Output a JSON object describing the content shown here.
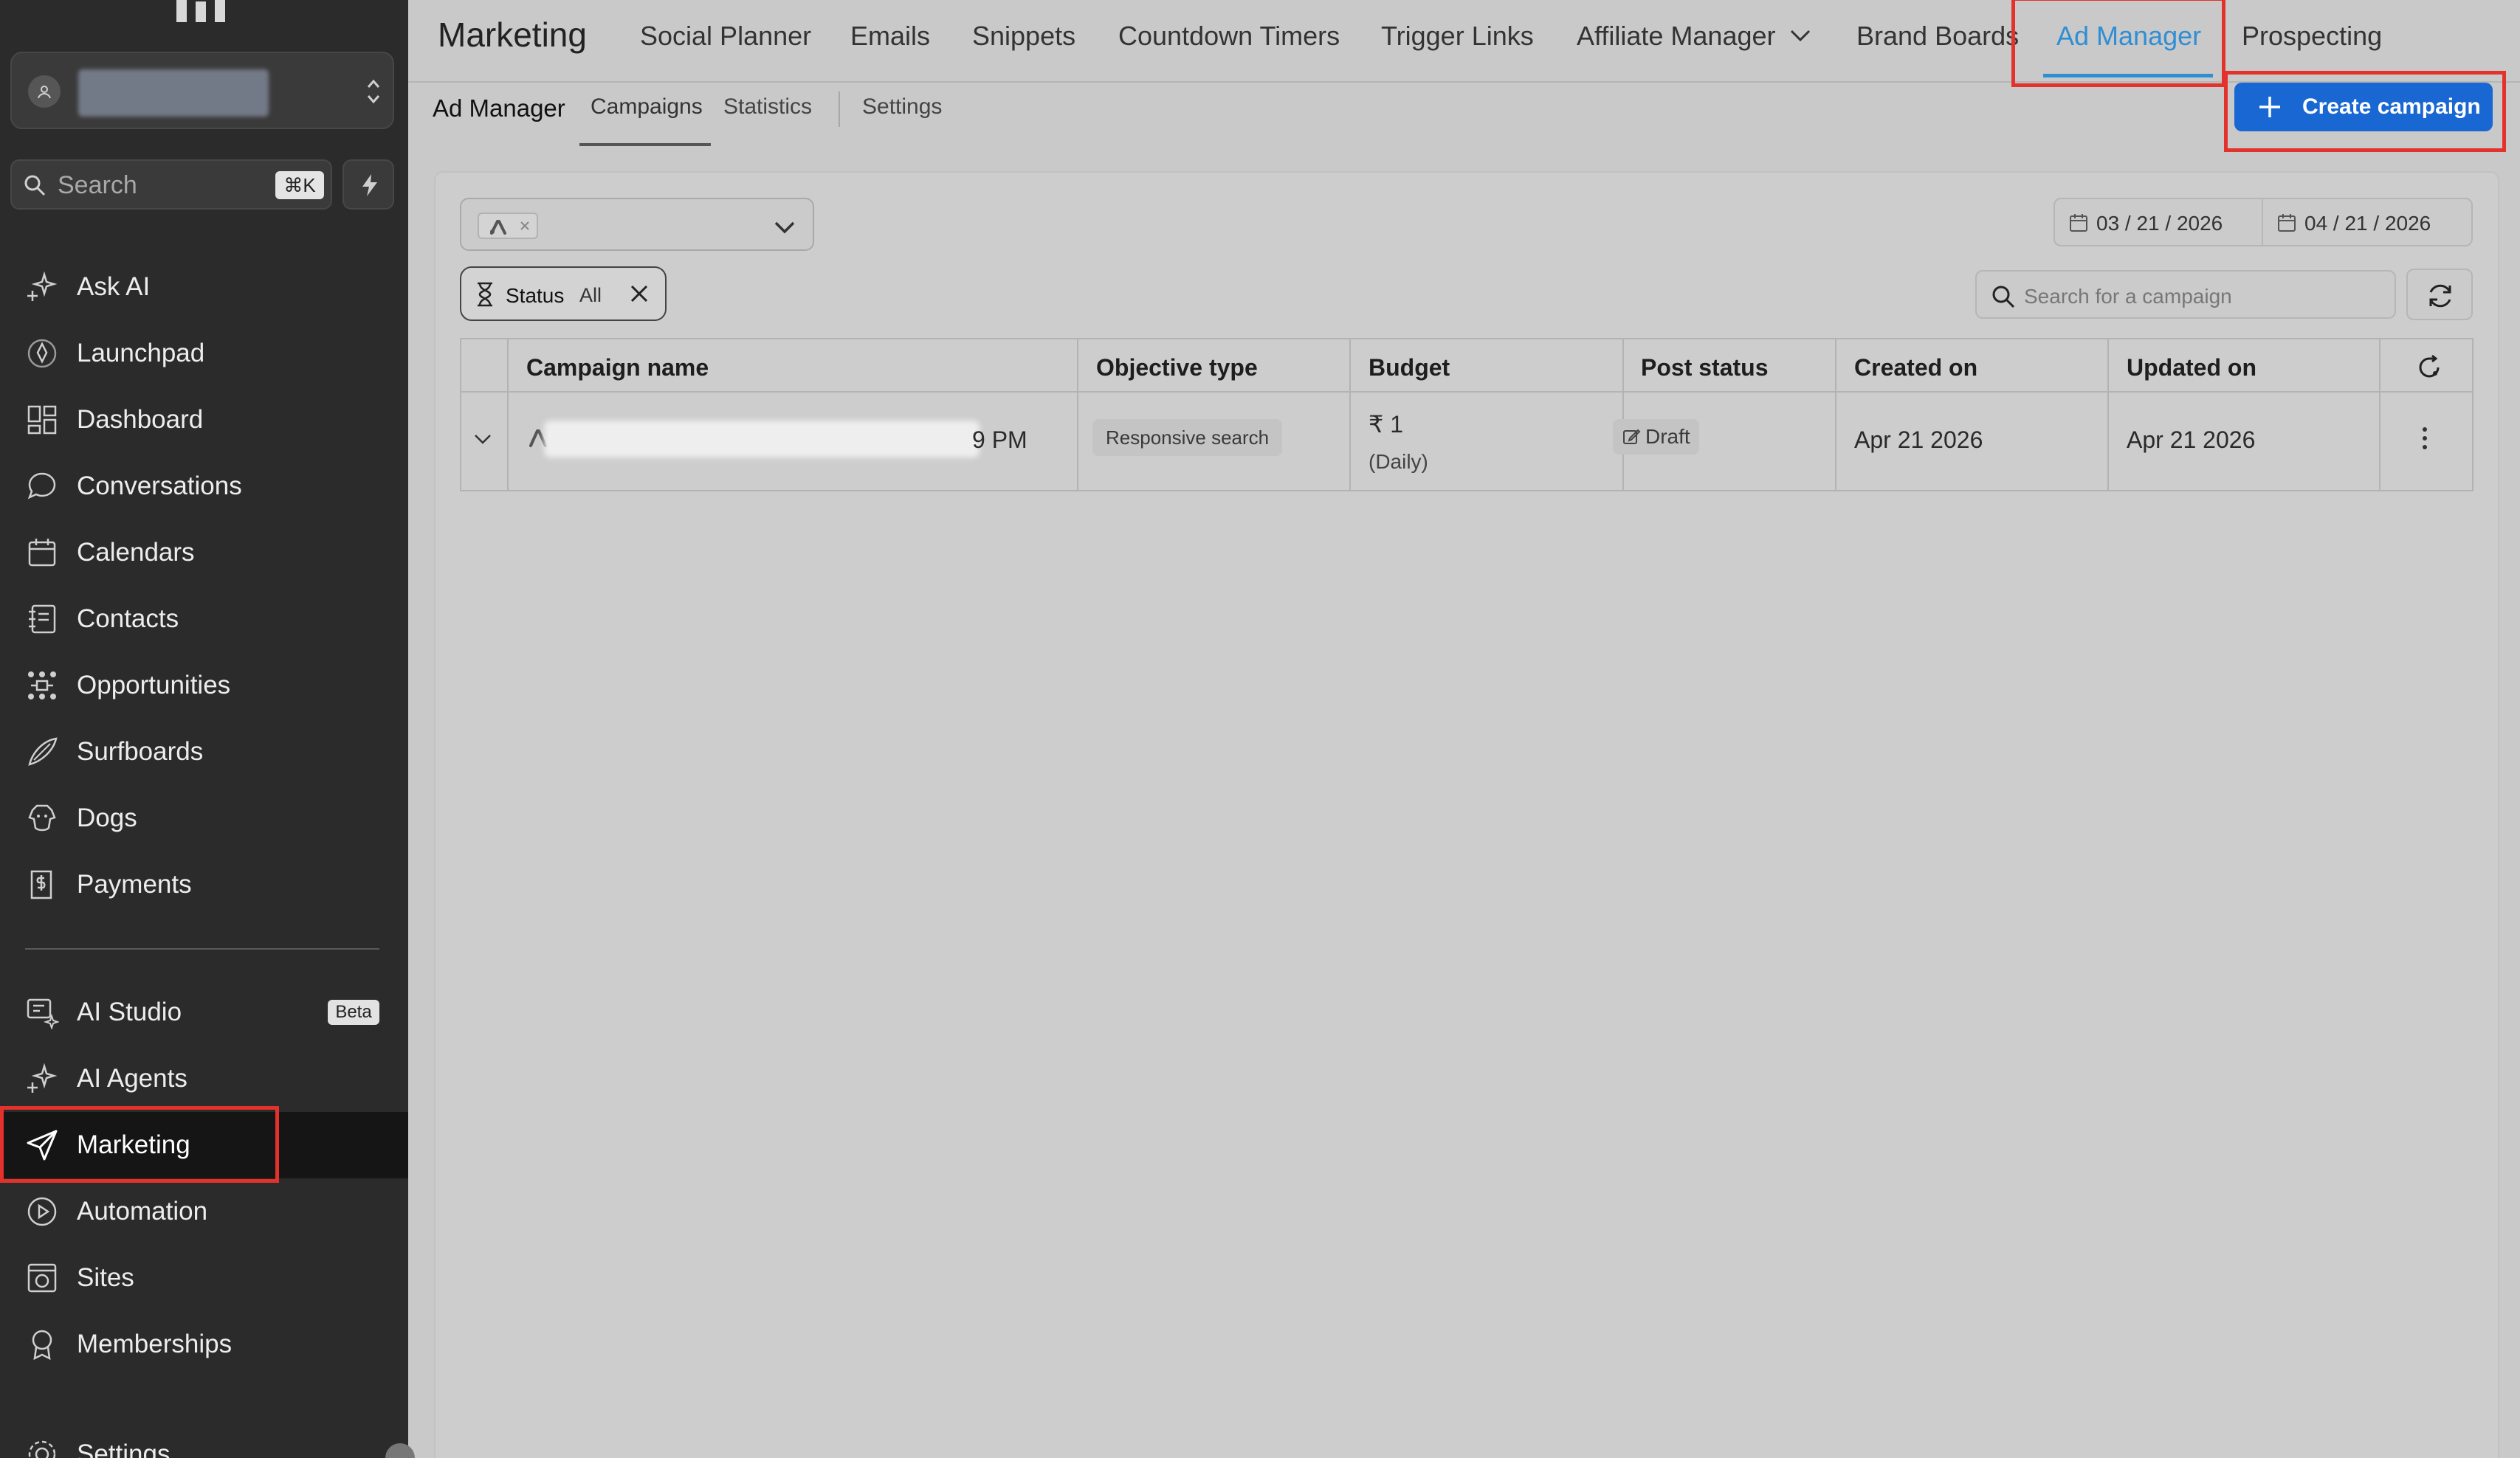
{
  "sidebar": {
    "search": {
      "placeholder": "Search",
      "shortcut": "⌘K"
    },
    "items_top": [
      {
        "label": "Ask AI",
        "icon": "sparkle-icon"
      },
      {
        "label": "Launchpad",
        "icon": "rocket-icon"
      },
      {
        "label": "Dashboard",
        "icon": "dashboard-grid-icon"
      },
      {
        "label": "Conversations",
        "icon": "chat-bubble-icon"
      },
      {
        "label": "Calendars",
        "icon": "calendar-icon"
      },
      {
        "label": "Contacts",
        "icon": "contacts-book-icon"
      },
      {
        "label": "Opportunities",
        "icon": "opportunities-icon"
      },
      {
        "label": "Surfboards",
        "icon": "surfboard-icon"
      },
      {
        "label": "Dogs",
        "icon": "dog-icon"
      },
      {
        "label": "Payments",
        "icon": "payments-icon"
      }
    ],
    "items_bottom": [
      {
        "label": "AI Studio",
        "icon": "ai-studio-icon",
        "badge": "Beta"
      },
      {
        "label": "AI Agents",
        "icon": "sparkle-icon"
      },
      {
        "label": "Marketing",
        "icon": "send-icon",
        "active": true
      },
      {
        "label": "Automation",
        "icon": "automation-icon"
      },
      {
        "label": "Sites",
        "icon": "sites-icon"
      },
      {
        "label": "Memberships",
        "icon": "award-icon"
      },
      {
        "label": "Settings",
        "icon": "gear-icon"
      }
    ]
  },
  "topnav": {
    "title": "Marketing",
    "tabs": [
      "Social Planner",
      "Emails",
      "Snippets",
      "Countdown Timers",
      "Trigger Links",
      "Affiliate Manager",
      "Brand Boards",
      "Ad Manager",
      "Prospecting"
    ],
    "active_tab": "Ad Manager"
  },
  "subnav": {
    "title": "Ad Manager",
    "tabs": [
      "Campaigns",
      "Statistics",
      "Settings"
    ],
    "active_tab": "Campaigns",
    "create_button": "Create campaign"
  },
  "filters": {
    "date_from": "03 / 21 / 2026",
    "date_to": "04 / 21 / 2026",
    "status_label": "Status",
    "status_value": "All",
    "search_placeholder": "Search for a campaign"
  },
  "table": {
    "columns": [
      "Campaign name",
      "Objective type",
      "Budget",
      "Post status",
      "Created on",
      "Updated on"
    ],
    "rows": [
      {
        "name_suffix": "9 PM",
        "objective": "Responsive search",
        "budget": "₹ 1",
        "budget_period": "(Daily)",
        "post_status": "Draft",
        "created_on": "Apr 21 2026",
        "updated_on": "Apr 21 2026"
      }
    ]
  },
  "colors": {
    "sidebar_bg": "#2b2b2b",
    "primary_button": "#1967d2",
    "active_tab": "#2f8ed4",
    "highlight_box": "#e3322c"
  }
}
